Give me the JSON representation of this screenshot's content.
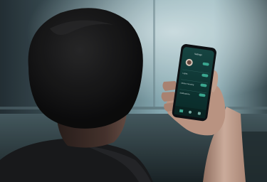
{
  "photo": {
    "subject": "person-holding-smartphone",
    "palette": {
      "window_light": "#cfe6ec",
      "room_shadow": "#2c3a40",
      "hair": "#141414",
      "skin_shadow": "#3d2e2a",
      "skin_lit": "#d9b5a3",
      "shirt": "#1d1d1f",
      "phone_body": "#111417",
      "screen_bg": "#0f3d3a",
      "screen_accent": "#3fb39b"
    }
  },
  "phone_app": {
    "title": "Settings",
    "rows": [
      {
        "label": "Lights",
        "toggle_on": true
      },
      {
        "label": "Motion Sensing",
        "toggle_on": true
      },
      {
        "label": "Notifications",
        "toggle_on": true
      }
    ],
    "nav_icons": [
      "home-icon",
      "activity-icon",
      "settings-icon"
    ]
  }
}
